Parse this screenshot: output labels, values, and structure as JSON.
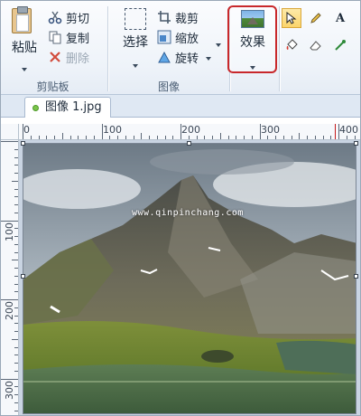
{
  "clipboard": {
    "paste_label": "粘贴",
    "cut_label": "剪切",
    "copy_label": "复制",
    "delete_label": "删除",
    "group_label": "剪贴板"
  },
  "image": {
    "select_label": "选择",
    "crop_label": "裁剪",
    "resize_label": "缩放",
    "rotate_label": "旋转",
    "group_label": "图像"
  },
  "effects": {
    "label": "效果"
  },
  "tools": {
    "text_icon": "A"
  },
  "document": {
    "tab_label": "图像 1.jpg"
  },
  "ruler": {
    "h_labels": [
      "0",
      "100",
      "200",
      "300",
      "400"
    ],
    "v_labels": [
      "100",
      "200",
      "300"
    ]
  },
  "photo": {
    "watermark": "www.qinpinchang.com"
  },
  "colors": {
    "highlight": "#c8282b",
    "accent": "#fbd46b"
  }
}
